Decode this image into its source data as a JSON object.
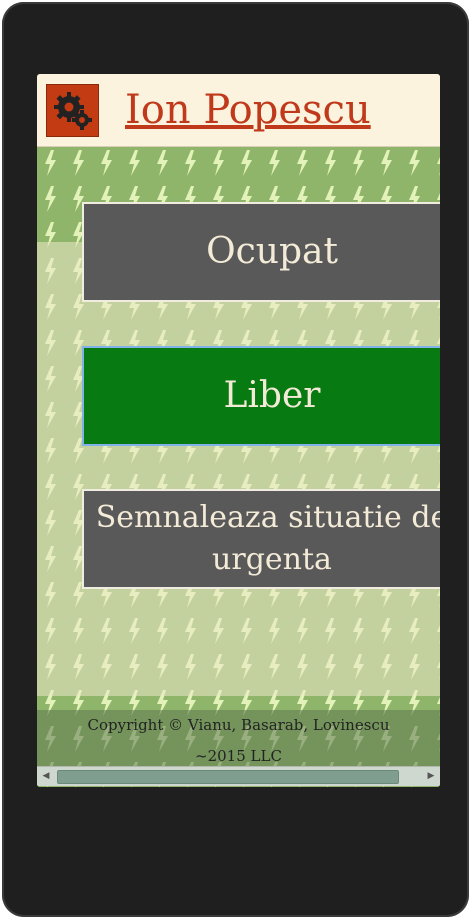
{
  "header": {
    "user_name": "Ion Popescu",
    "settings_icon": "gears-icon"
  },
  "actions": {
    "ocupat": "Ocupat",
    "liber": "Liber",
    "urgent": "Semnaleaza situatie de urgenta"
  },
  "footer": {
    "line1": "Copyright © Vianu, Basarab, Lovinescu",
    "line2": "~2015 LLC"
  },
  "colors": {
    "header_bg": "#fcf3df",
    "name_color": "#c0391b",
    "busy": "#595959",
    "free": "#087a12",
    "pattern": "#8fb56a"
  }
}
